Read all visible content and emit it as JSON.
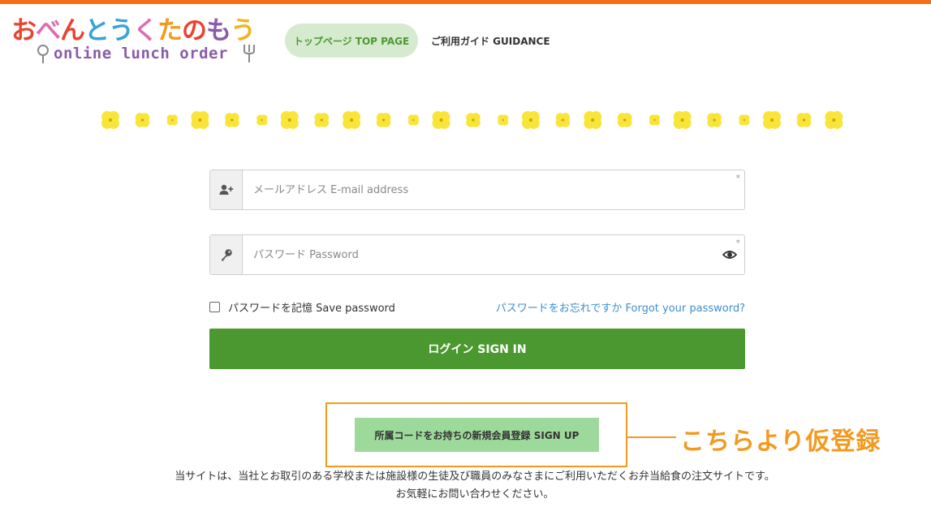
{
  "colors": {
    "top_bar": "#f36f16",
    "primary_green": "#4a982f",
    "signup_green": "#9dd99a",
    "nav_bg": "#d6ead0",
    "link_blue": "#3d8fcf",
    "callout_orange": "#f29a1e",
    "flower_yellow": "#f9e53a"
  },
  "logo": {
    "title_chars": [
      "お",
      "べ",
      "ん",
      "と",
      "う",
      "く",
      "た",
      "の",
      "も",
      "う"
    ],
    "title_colors": [
      "#e8442f",
      "#e06bb0",
      "#e8442f",
      "#3aa2d6",
      "#3aa2d6",
      "#e06bb0",
      "#f29a1e",
      "#e8442f",
      "#8a5ba8",
      "#f2b31e"
    ],
    "subtitle": "online lunch order",
    "icons": [
      "spoon-icon",
      "fork-icon"
    ]
  },
  "nav": {
    "home_label": "トップページ TOP PAGE",
    "guide_label": "ご利用ガイド GUIDANCE"
  },
  "form": {
    "email": {
      "placeholder": "メールアドレス E-mail address",
      "value": "",
      "required_mark": "*",
      "icon": "user-plus-icon"
    },
    "password": {
      "placeholder": "パスワード Password",
      "value": "",
      "required_mark": "*",
      "icon": "key-icon",
      "toggle_icon": "eye-icon"
    },
    "remember_label": "パスワードを記憶 Save password",
    "remember_checked": false,
    "forgot_label": "パスワードをお忘れですか Forgot your password?",
    "signin_label": "ログイン SIGN IN"
  },
  "signup": {
    "button_label": "所属コードをお持ちの新規会員登録 SIGN UP",
    "callout": "こちらより仮登録"
  },
  "footer": {
    "line1": "当サイトは、当社とお取引のある学校または施設様の生徒及び職員のみなさまにご利用いただくお弁当給食の注文サイトです。",
    "line2": "お気軽にお問い合わせください。"
  }
}
